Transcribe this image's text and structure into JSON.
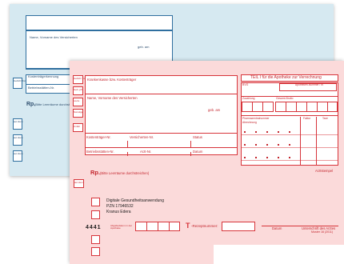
{
  "back_form": {
    "name_field_label": "Name, Vorname des Versicherten",
    "birth_label": "geb. am",
    "insurer_label": "Kostenträgerkennung",
    "site_label": "Betriebsstätten-Nr.",
    "rx_label": "Rp.",
    "rx_hint": "(Bitte Leerräume durchstreichen)",
    "side_boxes": [
      "Gebühr frei",
      "aut idem",
      "aut idem",
      "aut idem"
    ]
  },
  "front_form": {
    "header_right": "TEIL I für die Apotheke zur Verrechnung",
    "insurer_label": "Krankenkasse bzw. Kostenträger",
    "name_label": "Name, Vorname des Versicherten",
    "birth_label": "geb. am",
    "insurer_no_label": "Kostenträger-Nr.",
    "insured_no_label": "Versicherten-Nr.",
    "status_label": "Status",
    "site_label": "Betriebsstätten-Nr.",
    "doctor_no_label": "Arzt-Nr.",
    "date_label": "Datum",
    "rx_label": "Rp.",
    "rx_hint": "(Bitte Leerräume durchstreichen)",
    "left_boxes": [
      "Gebühr frei",
      "Geb.-pfl.",
      "noctu",
      "Sonstige",
      "Unfall"
    ],
    "bvg_label": "BVG",
    "pharmacy_no_label": "Apotheken-Nummer / IK",
    "copay_label": "Zuzahlung",
    "total_label": "Gesamt-Brutto",
    "pzn_label": "Pharmazentralnummer",
    "factor_label": "Faktor",
    "tax_label": "Taxe",
    "grid_row1_label": "Abrechnung",
    "stamp_label": "Arztstempel",
    "autidem_label": "aut idem",
    "prescription": {
      "line1": "Digitale Gesundheitsanwendung",
      "line2": "PZN 17946532",
      "line3": "Kranus Edera"
    },
    "code_number": "4441",
    "dispense_label": "Abgabedatum in der Apotheke",
    "t_letter": "T",
    "t_rx_label": "-Rezeptnummer:",
    "footer_date": "Datum",
    "footer_signature": "Unterschrift des Arztes",
    "footer_model": "Muster 16 (2011)"
  },
  "colors": {
    "back_form_bg": "#d6e9f1",
    "front_form_bg": "#fbdada",
    "accent_red": "#d7343a",
    "accent_blue": "#2f6f9f"
  }
}
